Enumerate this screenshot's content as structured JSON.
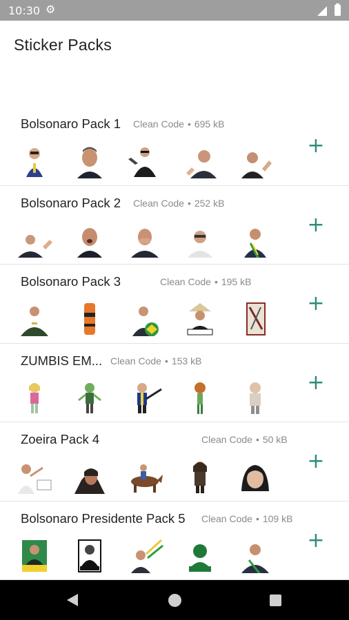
{
  "status_bar": {
    "time": "10:30",
    "icons": [
      "gear-icon",
      "signal-icon",
      "battery-icon"
    ]
  },
  "app": {
    "title": "Sticker Packs"
  },
  "accent_color": "#2e8b7a",
  "add_label": "+",
  "packs": [
    {
      "name": "Bolsonaro Pack 1",
      "publisher": "Clean Code",
      "separator": "•",
      "size": "695 kB"
    },
    {
      "name": "Bolsonaro Pack 2",
      "publisher": "Clean Code",
      "separator": "•",
      "size": "252 kB"
    },
    {
      "name": "Bolsonaro Pack 3",
      "publisher": "Clean Code",
      "separator": "•",
      "size": "195 kB"
    },
    {
      "name": "ZUMBIS EM...",
      "publisher": "Clean Code",
      "separator": "•",
      "size": "153 kB"
    },
    {
      "name": "Zoeira Pack 4",
      "publisher": "Clean Code",
      "separator": "•",
      "size": "50 kB"
    },
    {
      "name": "Bolsonaro Presidente Pack 5",
      "publisher": "Clean Code",
      "separator": "•",
      "size": "109 kB"
    }
  ],
  "nav": {
    "icons": [
      "back-icon",
      "home-icon",
      "recents-icon"
    ]
  }
}
